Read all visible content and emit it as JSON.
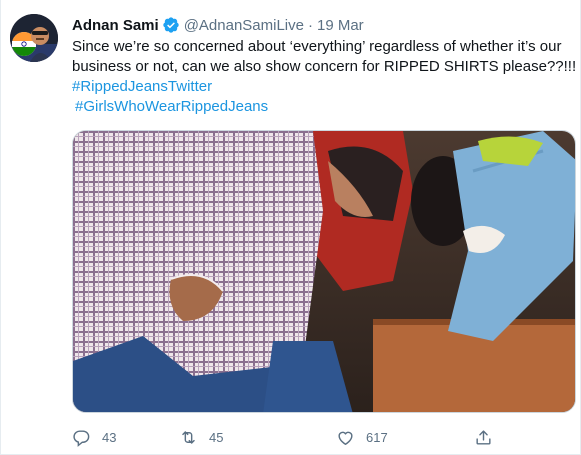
{
  "tweet": {
    "author": {
      "display_name": "Adnan Sami",
      "handle": "@AdnanSamiLive",
      "verified": true,
      "avatar_icon": "profile-avatar-flag"
    },
    "separator": "·",
    "date": "19 Mar",
    "text_lines": [
      "Since we’re so concerned about ‘everything’ regardless of whether it’s our",
      "business or not, can we also show concern for RIPPED SHIRTS please??!!!"
    ],
    "hashtags": [
      "#RippedJeansTwitter",
      "#GirlsWhoWearRippedJeans"
    ],
    "media": {
      "kind": "photo",
      "content": "man in checked shirt with torn belly area beside person in ripped jeans"
    },
    "actions": {
      "reply": {
        "icon": "reply-icon",
        "count": "43"
      },
      "retweet": {
        "icon": "retweet-icon",
        "count": "45"
      },
      "like": {
        "icon": "heart-icon",
        "count": "617"
      },
      "share": {
        "icon": "share-icon"
      }
    },
    "colors": {
      "link": "#1b95e0",
      "muted": "#5b7083",
      "text": "#0f1419",
      "verified": "#1da1f2"
    }
  }
}
